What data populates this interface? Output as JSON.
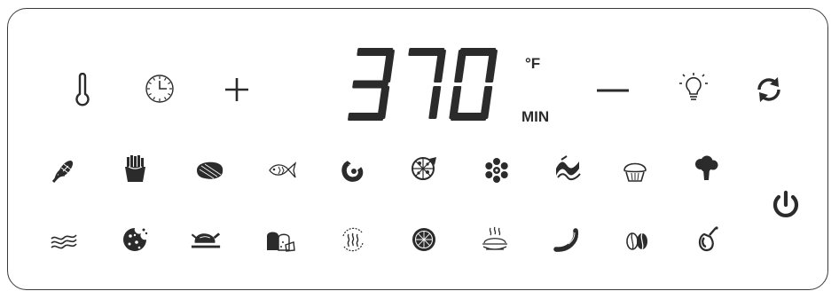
{
  "display": {
    "digits": "370",
    "temp_unit": "°F",
    "time_unit": "MIN"
  },
  "colors": {
    "ink": "#2b2b2b",
    "border": "#3a3a3a",
    "background": "#ffffff"
  },
  "controls": {
    "top_row": [
      "thermometer-icon",
      "clock-icon",
      "plus-icon",
      "minus-icon",
      "light-bulb-icon",
      "rotate-icon"
    ],
    "power": "power-icon"
  },
  "presets": {
    "row1": [
      "corn-icon",
      "fries-icon",
      "steak-icon",
      "fish-icon",
      "shrimp-icon",
      "pizza-icon",
      "defrost-icon",
      "bacon-wave-icon",
      "muffin-icon",
      "broccoli-icon"
    ],
    "row2": [
      "bacon-icon",
      "cookie-icon",
      "chicken-icon",
      "bread-icon",
      "reheat-icon",
      "dehydrate-icon",
      "warm-dish-icon",
      "sausage-icon",
      "coffee-beans-icon",
      "drumstick-icon"
    ]
  }
}
